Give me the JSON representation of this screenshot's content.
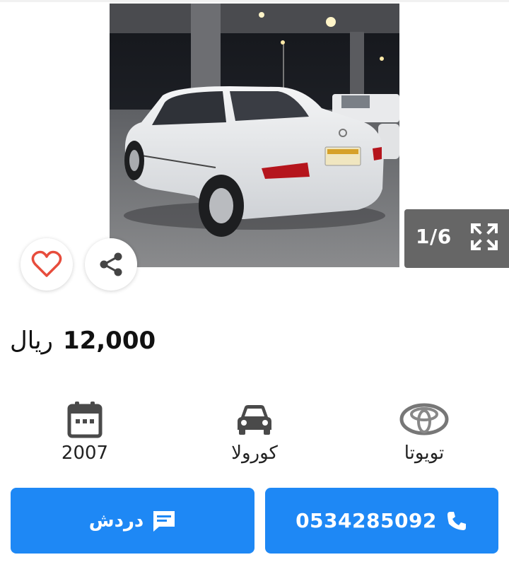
{
  "gallery": {
    "counter": "1/6",
    "icons": {
      "prev": "chevron-left-icon",
      "next": "chevron-right-icon",
      "expand": "expand-icon",
      "favorite": "heart-icon",
      "share": "share-icon"
    }
  },
  "listing": {
    "price": "12,000",
    "currency": "ريال"
  },
  "specs": {
    "year": {
      "value": "2007",
      "icon": "calendar-icon"
    },
    "model": {
      "value": "كورولا",
      "icon": "car-icon"
    },
    "make": {
      "value": "تويوتا",
      "icon": "toyota-logo-icon"
    }
  },
  "actions": {
    "chat_label": "دردش",
    "chat_icon": "chat-icon",
    "phone": "0534285092",
    "phone_icon": "phone-icon"
  },
  "colors": {
    "primary": "#1e88f5",
    "counter_bg": "#666666",
    "heart": "#e74c3c",
    "icon_dark": "#4a4a4a"
  }
}
